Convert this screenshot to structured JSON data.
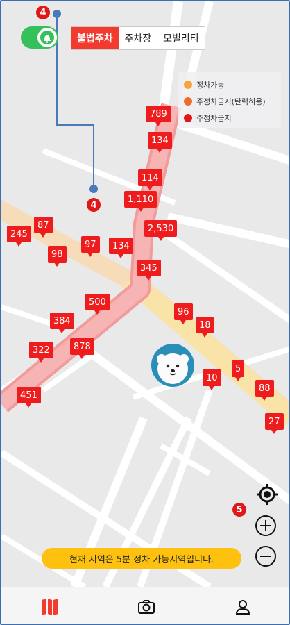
{
  "top": {
    "alarm_toggle": {
      "state": "on",
      "icon": "bell-icon"
    },
    "segments": [
      {
        "label": "불법주차",
        "active": true
      },
      {
        "label": "주차장",
        "active": false
      },
      {
        "label": "모빌리티",
        "active": false
      }
    ]
  },
  "legend": [
    {
      "label": "정차가능",
      "color": "#f6a53a"
    },
    {
      "label": "주정차금지(탄력허용)",
      "color": "#f06a2a"
    },
    {
      "label": "주정차금지",
      "color": "#e01818"
    }
  ],
  "markers": [
    "789",
    "134",
    "114",
    "1,110",
    "2,530",
    "245",
    "87",
    "98",
    "97",
    "134",
    "345",
    "500",
    "384",
    "322",
    "878",
    "451",
    "96",
    "18",
    "5",
    "10",
    "88",
    "27"
  ],
  "annotations": {
    "badge_top": "4",
    "badge_mid": "4",
    "badge_controls": "5"
  },
  "controls": {
    "locate_icon": "crosshair-icon",
    "zoom_in_icon": "plus-icon",
    "zoom_out_icon": "minus-icon"
  },
  "status_message": "현재 지역은 5분 정차 가능지역입니다.",
  "tabbar": [
    {
      "icon": "map-icon",
      "active": true,
      "color": "#f23a2e"
    },
    {
      "icon": "camera-icon",
      "active": false
    },
    {
      "icon": "user-icon",
      "active": false
    }
  ]
}
